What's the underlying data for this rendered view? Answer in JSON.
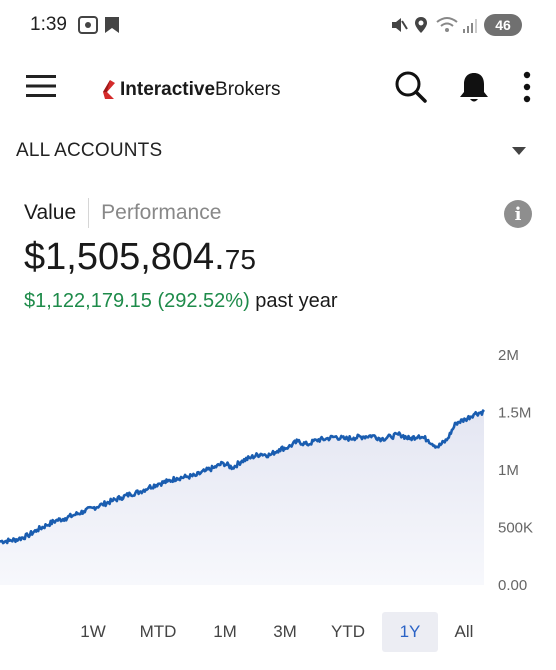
{
  "status_bar": {
    "time": "1:39",
    "battery": "46"
  },
  "app_bar": {
    "logo_part1": "Interactive",
    "logo_part2": "Brokers"
  },
  "accounts": {
    "label": "ALL ACCOUNTS"
  },
  "tabs": {
    "value": "Value",
    "performance": "Performance"
  },
  "summary": {
    "total_main": "$1,505,804.",
    "total_cents": "75",
    "change": "$1,122,179.15 (292.52%)",
    "change_suffix": " past year"
  },
  "colors": {
    "positive": "#1e8b4a",
    "line": "#1a5db0",
    "active_range": "#2b63c6"
  },
  "chart_data": {
    "type": "area",
    "y_ticks": [
      "2M",
      "1.5M",
      "1M",
      "500K",
      "0.00"
    ],
    "ylim": [
      0,
      2000000
    ],
    "values": [
      380000,
      385000,
      400000,
      430000,
      480000,
      520000,
      560000,
      580000,
      610000,
      640000,
      670000,
      700000,
      730000,
      760000,
      790000,
      810000,
      850000,
      880000,
      900000,
      930000,
      940000,
      950000,
      990000,
      1020000,
      1060000,
      1020000,
      1080000,
      1110000,
      1140000,
      1130000,
      1180000,
      1200000,
      1250000,
      1220000,
      1260000,
      1270000,
      1290000,
      1270000,
      1280000,
      1290000,
      1300000,
      1270000,
      1290000,
      1310000,
      1270000,
      1300000,
      1260000,
      1200000,
      1260000,
      1410000,
      1440000,
      1490000,
      1505805
    ]
  },
  "ranges": {
    "items": [
      "1W",
      "MTD",
      "1M",
      "3M",
      "YTD",
      "1Y",
      "All"
    ],
    "active": "1Y"
  }
}
